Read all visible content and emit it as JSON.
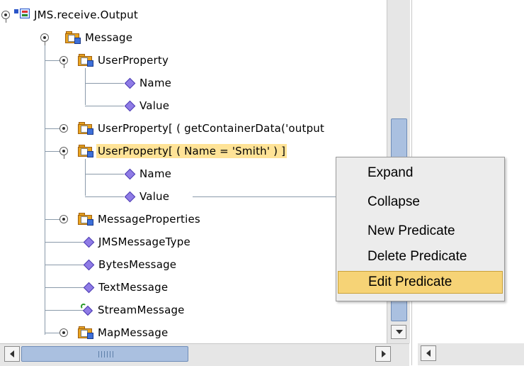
{
  "tree": {
    "root": "JMS.receive.Output",
    "message": "Message",
    "user_property": "UserProperty",
    "name": "Name",
    "value": "Value",
    "user_property_pred1": "UserProperty[ ( getContainerData('output",
    "user_property_pred2": "UserProperty[ ( Name = 'Smith' ) ]",
    "name2": "Name",
    "value2": "Value",
    "message_properties": "MessageProperties",
    "jms_message_type": "JMSMessageType",
    "bytes_message": "BytesMessage",
    "text_message": "TextMessage",
    "stream_message": "StreamMessage",
    "map_message": "MapMessage"
  },
  "context_menu": {
    "items": [
      "Expand",
      "Collapse",
      "New Predicate",
      "Delete Predicate",
      "Edit Predicate"
    ],
    "active_index": 4
  },
  "colors": {
    "selection": "#ffe397",
    "menu_highlight": "#f6d376",
    "scroll_thumb": "#aac0e0",
    "leaf_icon": "#8f7be6"
  }
}
